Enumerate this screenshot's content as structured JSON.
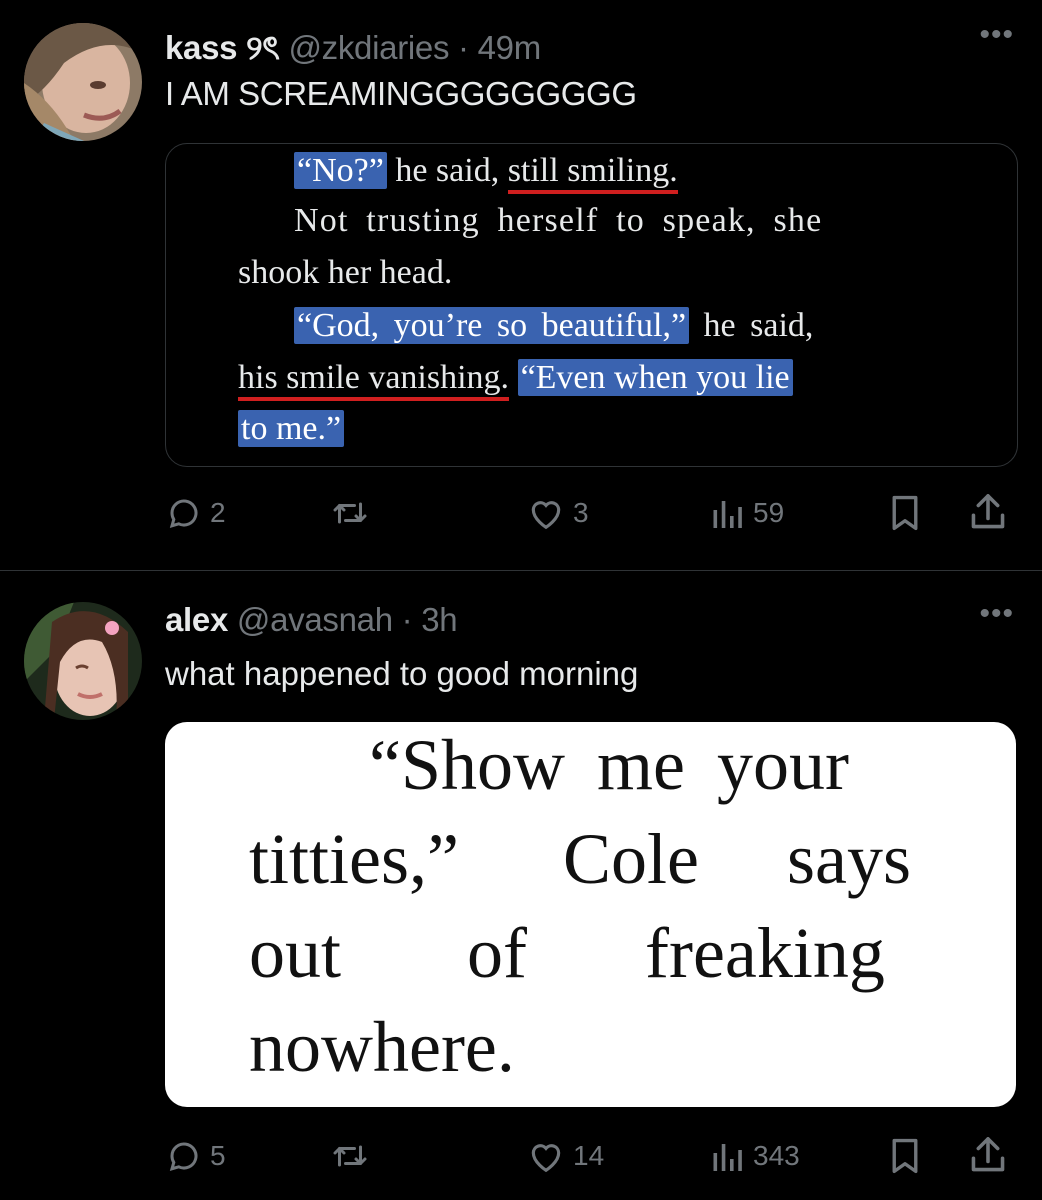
{
  "tweets": [
    {
      "name": "kass",
      "name_emoji": "୨ৎ",
      "handle": "@zkdiaries",
      "sep": "·",
      "time": "49m",
      "text": "I AM SCREAMINGGGGGGGGG",
      "more": "•••",
      "excerpt": {
        "l1a": "“No?”",
        "l1b": " he said, ",
        "l1c": "still smiling.",
        "l2": "Not trusting herself to speak, she",
        "l3": "shook her head.",
        "l4a": "“God, you’re so beautiful,”",
        "l4b": " he said,",
        "l5a": "his smile vanishing.",
        "l5b": " ",
        "l5c": "“Even when you lie",
        "l6": "to me.”"
      },
      "stats": {
        "replies": "2",
        "reposts": "",
        "likes": "3",
        "views": "59"
      }
    },
    {
      "name": "alex",
      "handle": "@avasnah",
      "sep": "·",
      "time": "3h",
      "text": "what happened to good morning",
      "more": "•••",
      "excerpt": {
        "l1": "“Show me your",
        "l2a": "titties,”",
        "l2b": "Cole",
        "l2c": "says",
        "l3a": "out",
        "l3b": "of",
        "l3c": "freaking",
        "l4": "nowhere."
      },
      "stats": {
        "replies": "5",
        "reposts": "",
        "likes": "14",
        "views": "343"
      }
    }
  ],
  "icons": {
    "reply": "speech-bubble-icon",
    "repost": "repost-arrows-icon",
    "like": "heart-icon",
    "views": "bar-chart-icon",
    "bookmark": "bookmark-icon",
    "share": "share-upload-icon"
  },
  "colors": {
    "background": "#000000",
    "text": "#e7e9ea",
    "muted": "#71767b",
    "highlight": "#3a63b0",
    "underline": "#d01f1f"
  }
}
